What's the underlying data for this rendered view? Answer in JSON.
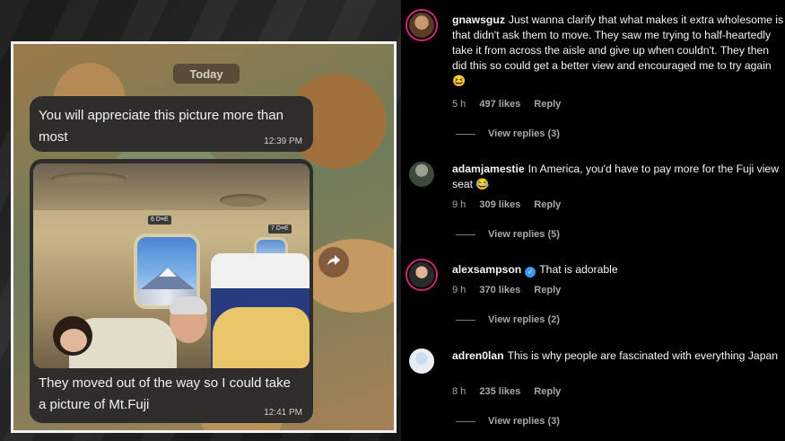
{
  "chat": {
    "date_label": "Today",
    "messages": [
      {
        "text": "You will appreciate this picture more than most",
        "time": "12:39 PM"
      },
      {
        "text": "They moved out of the way so I could take a picture of Mt.Fuji",
        "time": "12:41 PM"
      }
    ],
    "photo_signs": [
      "6 D≡E",
      "7 D≡E"
    ]
  },
  "comments": [
    {
      "username": "gnawsguz",
      "text": "Just wanna clarify that what makes it extra wholesome is that didn't ask them to move. They saw me trying to half-heartedly take it from across the aisle and give up when couldn't. They then did this so could get a better view and encouraged me to try again 😆",
      "time": "5 h",
      "likes": "497 likes",
      "reply": "Reply",
      "view_replies": "View replies (3)"
    },
    {
      "username": "adamjamestie",
      "text": "In America, you'd have to pay more for the Fuji view seat 😂",
      "time": "9 h",
      "likes": "309 likes",
      "reply": "Reply",
      "view_replies": "View replies (5)"
    },
    {
      "username": "alexsampson",
      "verified": true,
      "text": "That is adorable",
      "time": "9 h",
      "likes": "370 likes",
      "reply": "Reply",
      "view_replies": "View replies (2)"
    },
    {
      "username": "adren0lan",
      "text": "This is why people are fascinated with everything Japan",
      "time": "8 h",
      "likes": "235 likes",
      "reply": "Reply",
      "view_replies": "View replies (3)"
    }
  ]
}
